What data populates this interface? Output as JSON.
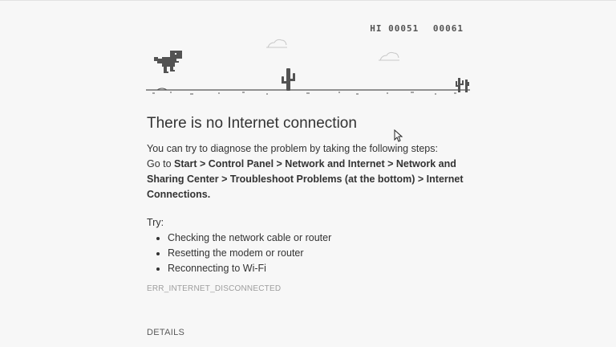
{
  "game": {
    "hi_label": "HI",
    "hi_score": "00051",
    "current_score": "00061"
  },
  "error": {
    "title": "There is no Internet connection",
    "diagnose_intro": "You can try to diagnose the problem by taking the following steps:",
    "goto_prefix": "Go to ",
    "path_start": "Start",
    "sep": " > ",
    "path_control_panel": "Control Panel",
    "path_network_internet": "Network and Internet",
    "path_network_sharing": "Network and Sharing Center",
    "path_troubleshoot": "Troubleshoot Problems (at the bottom)",
    "path_internet_connections": "Internet Connections",
    "end_punct": ".",
    "try_label": "Try:",
    "suggestions": [
      "Checking the network cable or router",
      "Resetting the modem or router",
      "Reconnecting to Wi-Fi"
    ],
    "error_code": "ERR_INTERNET_DISCONNECTED",
    "details_label": "DETAILS"
  },
  "colors": {
    "background": "#f7f7f7",
    "sprite": "#535353",
    "text": "#333333",
    "muted": "#9e9e9e"
  }
}
